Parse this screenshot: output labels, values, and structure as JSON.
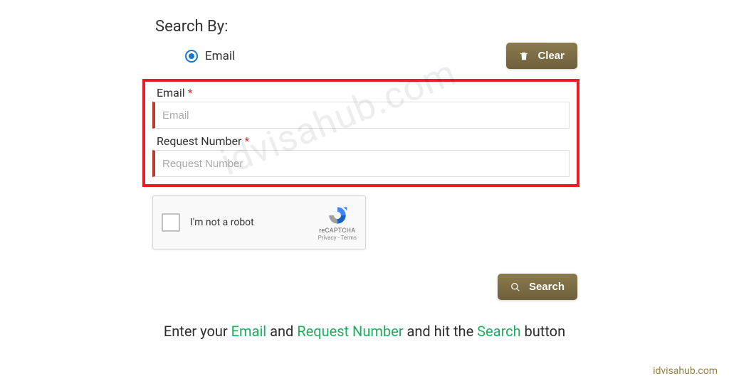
{
  "search_by_label": "Search By:",
  "radio": {
    "label": "Email"
  },
  "buttons": {
    "clear": "Clear",
    "search": "Search"
  },
  "fields": {
    "email": {
      "label": "Email",
      "required": "*",
      "placeholder": "Email"
    },
    "request_number": {
      "label": "Request Number",
      "required": "*",
      "placeholder": "Request Number"
    }
  },
  "recaptcha": {
    "text": "I'm not a robot",
    "brand": "reCAPTCHA",
    "privacy": "Privacy",
    "terms": "Terms"
  },
  "caption": {
    "t1": "Enter your ",
    "email": "Email",
    "t2": " and ",
    "request": "Request Number",
    "t3": " and hit the ",
    "search": "Search",
    "t4": " button"
  },
  "watermark": "idvisahub.com",
  "site_credit": "idvisahub.com"
}
